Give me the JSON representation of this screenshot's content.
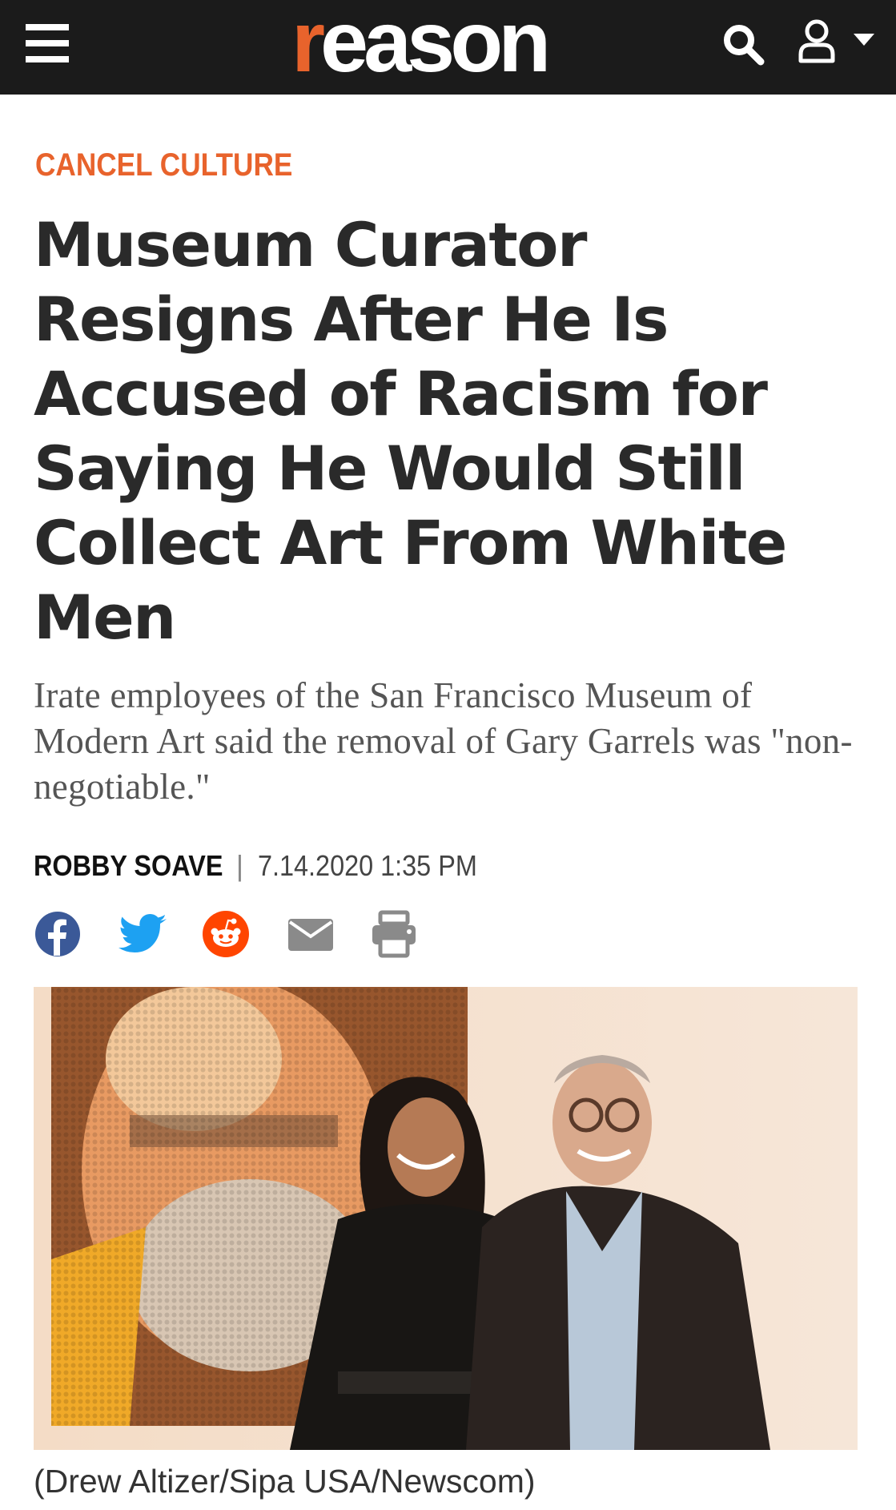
{
  "header": {
    "logo_text": "reason",
    "logo_first_letter": "r",
    "logo_rest": "eason",
    "menu_icon": "hamburger-menu-icon",
    "search_icon": "search-icon",
    "account_icon": "user-icon",
    "account_dropdown_icon": "caret-down-icon",
    "brand_color": "#e8632c",
    "bar_color": "#1b1b1b"
  },
  "article": {
    "category": "CANCEL CULTURE",
    "headline": "Museum Curator Resigns After He Is Accused of Racism for Saying He Would Still Collect Art From White Men",
    "dek": "Irate employees of the San Francisco Museum of Modern Art said the removal of Gary Garrels was \"non-negotiable.\"",
    "author": "ROBBY SOAVE",
    "separator": "|",
    "date": "7.14.2020 1:35 PM",
    "share_icons": [
      "facebook-icon",
      "twitter-icon",
      "reddit-icon",
      "email-icon",
      "print-icon"
    ],
    "photo_caption": "(Drew Altizer/Sipa USA/Newscom)"
  },
  "colors": {
    "facebook": "#3b5998",
    "twitter": "#1da1f2",
    "reddit": "#ff4500",
    "neutral_icon": "#8a8a8a"
  }
}
